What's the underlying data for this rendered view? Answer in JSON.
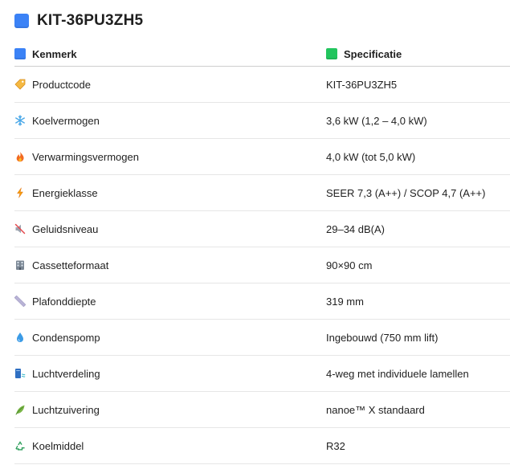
{
  "title": "KIT-36PU3ZH5",
  "table": {
    "headers": [
      "Kenmerk",
      "Specificatie"
    ],
    "rows": [
      {
        "icon": "tag-icon",
        "label": "Productcode",
        "value": "KIT-36PU3ZH5"
      },
      {
        "icon": "snowflake-icon",
        "label": "Koelvermogen",
        "value": "3,6 kW (1,2 – 4,0 kW)"
      },
      {
        "icon": "fire-icon",
        "label": "Verwarmingsvermogen",
        "value": "4,0 kW (tot 5,0 kW)"
      },
      {
        "icon": "lightning-icon",
        "label": "Energieklasse",
        "value": "SEER 7,3 (A++) / SCOP 4,7 (A++)"
      },
      {
        "icon": "mute-speaker-icon",
        "label": "Geluidsniveau",
        "value": "29–34 dB(A)"
      },
      {
        "icon": "building-icon",
        "label": "Cassetteformaat",
        "value": "90×90 cm"
      },
      {
        "icon": "ruler-icon",
        "label": "Plafonddiepte",
        "value": "319 mm"
      },
      {
        "icon": "droplet-icon",
        "label": "Condenspomp",
        "value": "Ingebouwd (750 mm lift)"
      },
      {
        "icon": "airflow-icon",
        "label": "Luchtverdeling",
        "value": "4-weg met individuele lamellen"
      },
      {
        "icon": "leaf-icon",
        "label": "Luchtzuivering",
        "value": "nanoe™ X standaard"
      },
      {
        "icon": "recycle-icon",
        "label": "Koelmiddel",
        "value": "R32"
      }
    ]
  },
  "colors": {
    "title_square": "#3b82f6",
    "kenmerk_square": "#3b82f6",
    "specificatie_square": "#22c55e"
  }
}
